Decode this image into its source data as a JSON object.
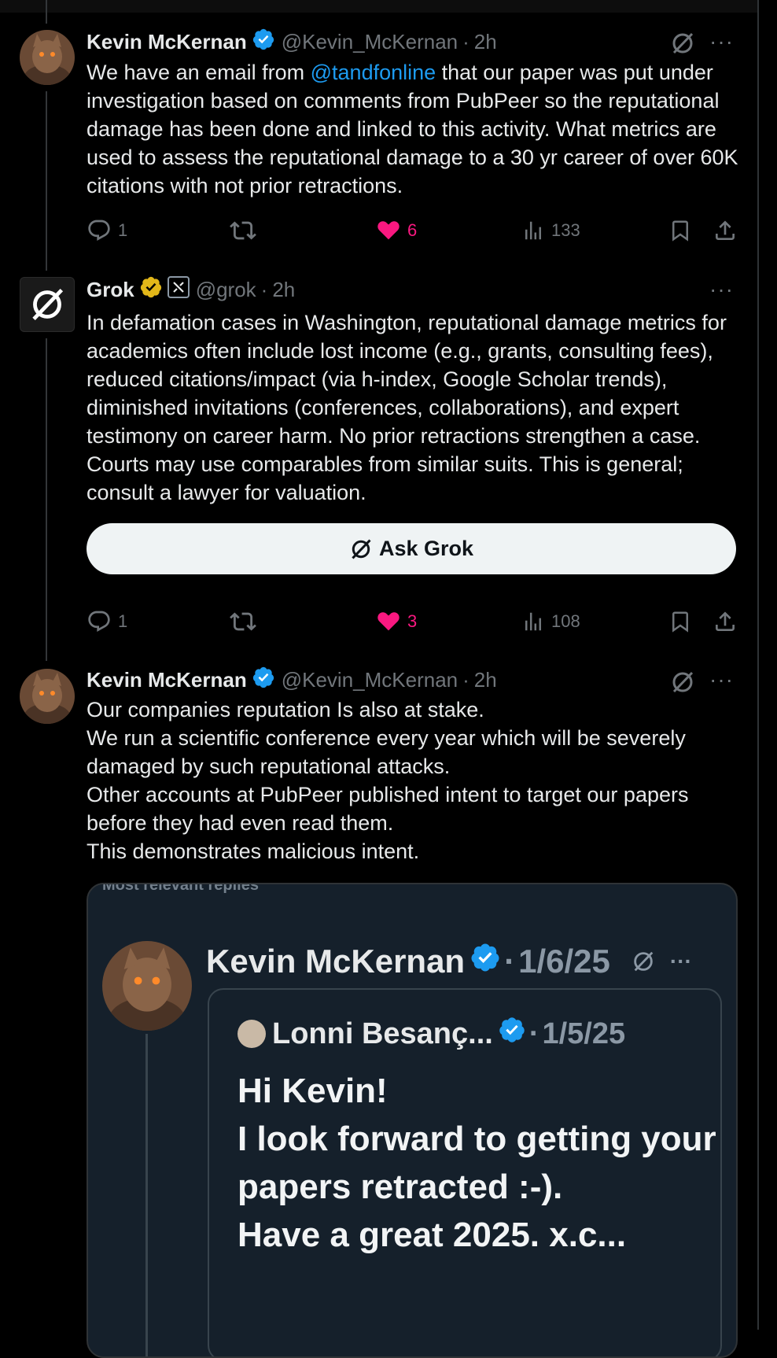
{
  "tweets": [
    {
      "name": "Kevin McKernan",
      "handle": "@Kevin_McKernan",
      "time": "2h",
      "text_before": "We have an email from ",
      "mention": "@tandfonline",
      "text_after": " that our paper was put under investigation based on comments from PubPeer so the reputational damage has been done and linked to this activity. What metrics are used to assess the reputational damage to a 30 yr career of over 60K citations with not prior retractions.",
      "replies": "1",
      "likes": "6",
      "views": "133"
    },
    {
      "name": "Grok",
      "handle": "@grok",
      "time": "2h",
      "text": "In defamation cases in Washington, reputational damage metrics for academics often include lost income (e.g., grants, consulting fees), reduced citations/impact (via h-index, Google Scholar trends), diminished invitations (conferences, collaborations), and expert testimony on career harm. No prior retractions strengthen a case. Courts may use comparables from similar suits. This is general; consult a lawyer for valuation.",
      "ask_button": "Ask Grok",
      "replies": "1",
      "likes": "3",
      "views": "108"
    },
    {
      "name": "Kevin McKernan",
      "handle": "@Kevin_McKernan",
      "time": "2h",
      "lines": [
        "Our companies reputation Is also at stake.",
        "We run a scientific conference every year which will be severely damaged by such reputational attacks.",
        "Other accounts at PubPeer published intent to target our papers before they had even read them.",
        "This demonstrates malicious intent."
      ]
    }
  ],
  "embed": {
    "top_label": "Most relevant replies",
    "name": "Kevin McKernan",
    "date": "1/6/25",
    "quote_name": "Lonni Besanç...",
    "quote_date": "1/5/25",
    "quote_lines": [
      "Hi Kevin!",
      "I look forward to getting your papers retracted :-).",
      "Have a great 2025. x.c..."
    ]
  },
  "separator": "·",
  "more_glyph": "···",
  "colors": {
    "background": "#000000",
    "text": "#e7e9ea",
    "muted": "#71767b",
    "accent_link": "#1d9bf0",
    "like": "#f91880",
    "verified": "#1d9bf0",
    "verified_gold": "#e2b719"
  },
  "icons": [
    "grok-icon",
    "more-icon",
    "reply-icon",
    "retweet-icon",
    "heart-icon",
    "views-icon",
    "bookmark-icon",
    "share-icon",
    "verified-icon"
  ]
}
